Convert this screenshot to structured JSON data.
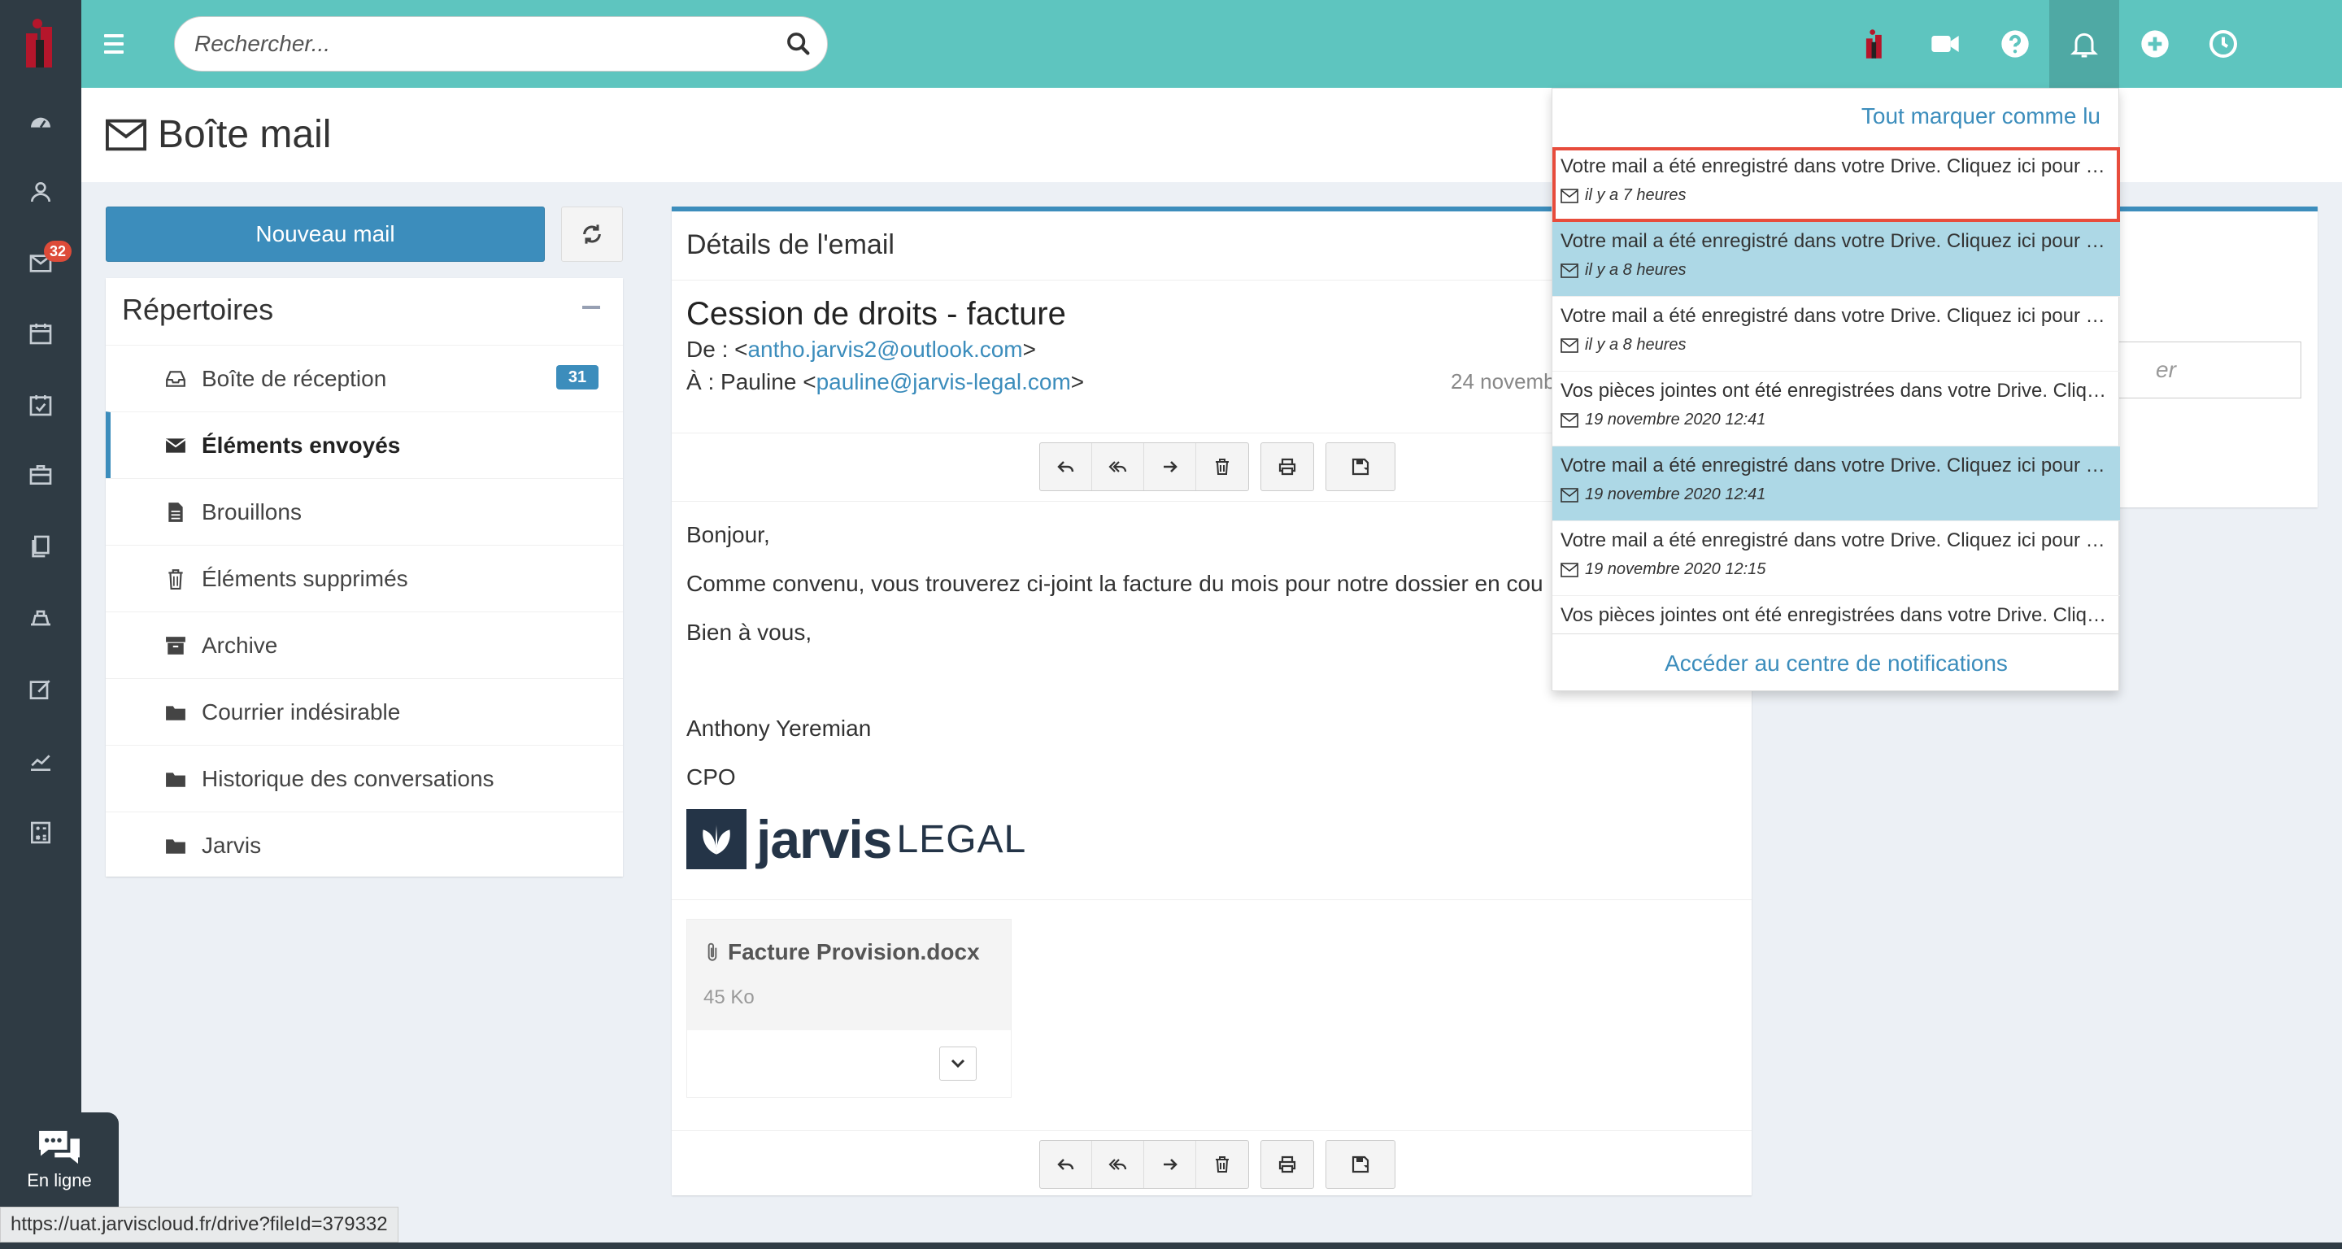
{
  "header": {
    "search_placeholder": "Rechercher..."
  },
  "sidebar": {
    "mail_badge": "32",
    "icons": [
      "dashboard-icon",
      "contacts-icon",
      "mail-icon",
      "calendar-icon",
      "tasks-icon",
      "briefcase-icon",
      "documents-icon",
      "billing-icon",
      "edit-icon",
      "chart-icon",
      "calculator-icon"
    ]
  },
  "page": {
    "title": "Boîte mail",
    "new_mail_label": "Nouveau mail"
  },
  "folders": {
    "title": "Répertoires",
    "items": [
      {
        "label": "Boîte de réception",
        "badge": "31"
      },
      {
        "label": "Éléments envoyés"
      },
      {
        "label": "Brouillons"
      },
      {
        "label": "Éléments supprimés"
      },
      {
        "label": "Archive"
      },
      {
        "label": "Courrier indésirable"
      },
      {
        "label": "Historique des conversations"
      },
      {
        "label": "Jarvis"
      }
    ]
  },
  "email": {
    "box_title": "Détails de l'email",
    "subject": "Cession de droits - facture",
    "from_label": "De : <",
    "from_email": "antho.jarvis2@outlook.com",
    "from_end": ">",
    "to_label": "À : Pauline <",
    "to_email": "pauline@jarvis-legal.com",
    "to_end": ">",
    "date": "24 novemb",
    "body": {
      "greeting": "Bonjour,",
      "line1": "Comme convenu, vous trouverez ci-joint la facture du mois pour notre dossier en cou",
      "closing": "Bien à vous,",
      "signature_name": "Anthony Yeremian",
      "signature_role": "CPO",
      "logo_word": "jarvis",
      "logo_suffix": "LEGAL"
    },
    "attachment": {
      "name": "Facture Provision.docx",
      "size": "45 Ko"
    }
  },
  "right_panel": {
    "input_partial": "er"
  },
  "notifications": {
    "mark_all_read": "Tout marquer comme lu",
    "footer_link": "Accéder au centre de notifications",
    "items": [
      {
        "text": "Votre mail a été enregistré dans votre Drive. Cliquez ici pour y accéder.",
        "time": "il y a 7 heures"
      },
      {
        "text": "Votre mail a été enregistré dans votre Drive. Cliquez ici pour y accéder.",
        "time": "il y a 8 heures"
      },
      {
        "text": "Votre mail a été enregistré dans votre Drive. Cliquez ici pour y accéder.",
        "time": "il y a 8 heures"
      },
      {
        "text": "Vos pièces jointes ont été enregistrées dans votre Drive. Cliquez ici pour y accéder.",
        "time": "19 novembre 2020 12:41"
      },
      {
        "text": "Votre mail a été enregistré dans votre Drive. Cliquez ici pour y accéder.",
        "time": "19 novembre 2020 12:41"
      },
      {
        "text": "Votre mail a été enregistré dans votre Drive. Cliquez ici pour y accéder.",
        "time": "19 novembre 2020 12:15"
      },
      {
        "text": "Vos pièces jointes ont été enregistrées dans votre Drive. Cliquez ici pour y accéder.",
        "time": ""
      }
    ]
  },
  "chat": {
    "status_label": "En ligne"
  },
  "status_bar": {
    "url": "https://uat.jarviscloud.fr/drive?fileId=379332"
  },
  "colors": {
    "header": "#5ec5bf",
    "sidebar": "#2f3b44",
    "primary": "#3c8dbc",
    "unread": "#add8e6",
    "highlight": "#e74c3c"
  }
}
